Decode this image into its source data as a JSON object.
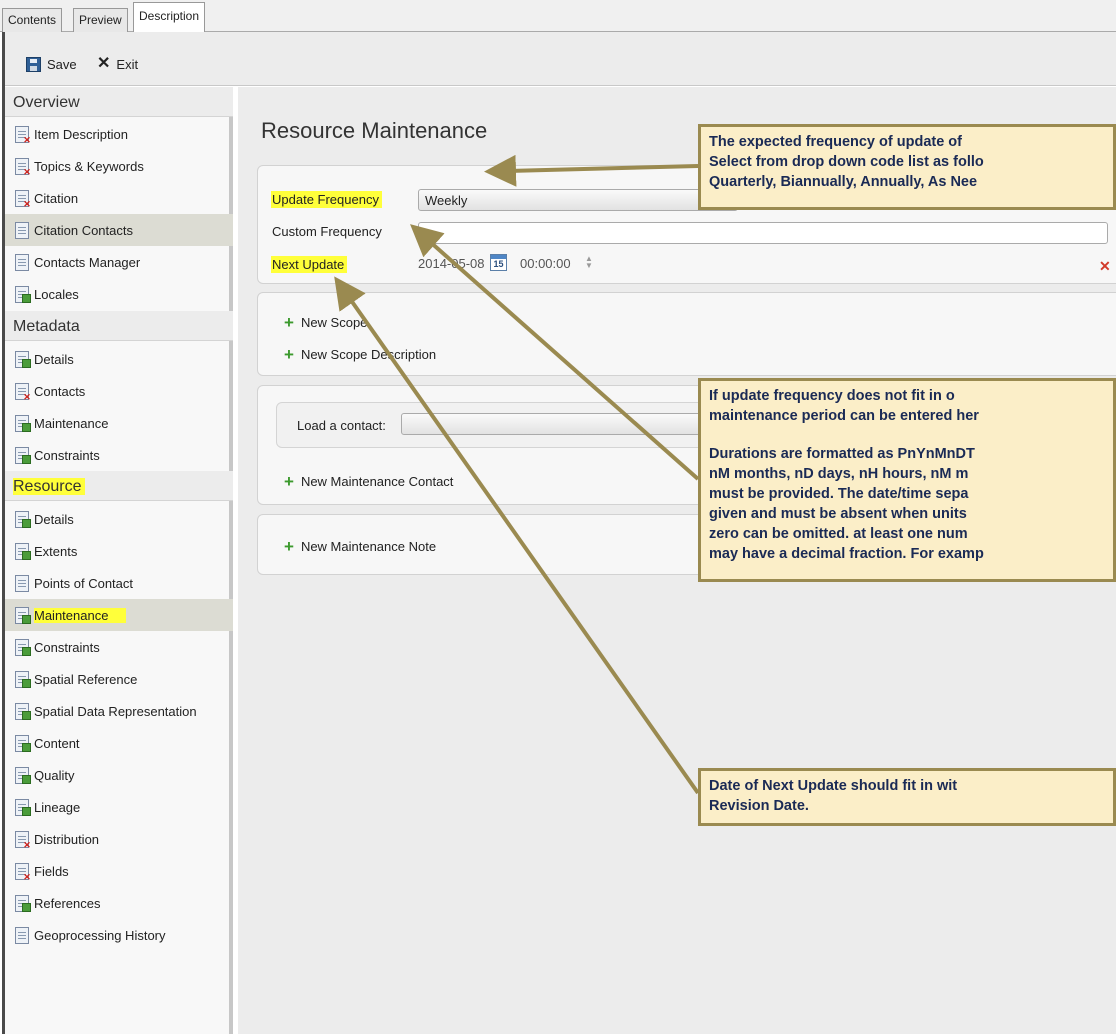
{
  "tabs": [
    {
      "label": "Contents"
    },
    {
      "label": "Preview"
    },
    {
      "label": "Description"
    }
  ],
  "toolbar": {
    "save_label": "Save",
    "exit_label": "Exit"
  },
  "sidebar": {
    "overview": {
      "header": "Overview",
      "items": [
        {
          "label": "Item Description",
          "icon": "document-error-icon"
        },
        {
          "label": "Topics & Keywords",
          "icon": "document-error-icon"
        },
        {
          "label": "Citation",
          "icon": "document-error-icon"
        },
        {
          "label": "Citation Contacts",
          "icon": "document-icon"
        },
        {
          "label": "Contacts Manager",
          "icon": "document-icon"
        },
        {
          "label": "Locales",
          "icon": "document-ok-icon"
        }
      ]
    },
    "metadata": {
      "header": "Metadata",
      "items": [
        {
          "label": "Details",
          "icon": "document-ok-icon"
        },
        {
          "label": "Contacts",
          "icon": "document-error-icon"
        },
        {
          "label": "Maintenance",
          "icon": "document-ok-icon"
        },
        {
          "label": "Constraints",
          "icon": "document-ok-icon"
        }
      ]
    },
    "resource": {
      "header": "Resource",
      "items": [
        {
          "label": "Details",
          "icon": "document-ok-icon"
        },
        {
          "label": "Extents",
          "icon": "document-ok-icon"
        },
        {
          "label": "Points of Contact",
          "icon": "document-icon"
        },
        {
          "label": "Maintenance",
          "icon": "document-ok-icon"
        },
        {
          "label": "Constraints",
          "icon": "document-ok-icon"
        },
        {
          "label": "Spatial Reference",
          "icon": "document-ok-icon"
        },
        {
          "label": "Spatial Data Representation",
          "icon": "document-ok-icon"
        },
        {
          "label": "Content",
          "icon": "document-ok-icon"
        },
        {
          "label": "Quality",
          "icon": "document-ok-icon"
        },
        {
          "label": "Lineage",
          "icon": "document-ok-icon"
        },
        {
          "label": "Distribution",
          "icon": "document-error-icon"
        },
        {
          "label": "Fields",
          "icon": "document-error-icon"
        },
        {
          "label": "References",
          "icon": "document-ok-icon"
        },
        {
          "label": "Geoprocessing History",
          "icon": "document-icon"
        }
      ]
    }
  },
  "main": {
    "title": "Resource Maintenance",
    "update_frequency_label": "Update Frequency",
    "update_frequency_value": "Weekly",
    "custom_frequency_label": "Custom Frequency",
    "custom_frequency_value": "",
    "next_update_label": "Next Update",
    "next_update_date": "2014-05-08",
    "calendar_day": "15",
    "next_update_time": "00:00:00",
    "new_scope": "New Scope",
    "new_scope_description": "New Scope Description",
    "load_contact_label": "Load a contact:",
    "new_maintenance_contact": "New Maintenance Contact",
    "new_maintenance_note": "New Maintenance Note"
  },
  "callouts": {
    "frequency": [
      "The expected frequency of update of",
      "Select from drop down code list as follo",
      "Quarterly, Biannually, Annually, As Nee"
    ],
    "custom": [
      "If update frequency does not fit in o",
      "maintenance period can be entered her",
      "",
      "Durations are formatted as PnYnMnDT",
      "nM months, nD days, nH hours, nM m",
      "must be provided. The date/time sepa",
      "given and must be absent when units",
      "zero can be omitted. at least one num",
      "may have a decimal fraction. For examp"
    ],
    "next_update": [
      "Date of Next Update should fit in wit",
      "Revision Date."
    ]
  },
  "colors": {
    "highlight": "#ffff3a",
    "callout_bg": "#fbeec8",
    "callout_border": "#9a8a50",
    "arrow": "#9a8a50",
    "callout_text": "#1a2a55"
  }
}
